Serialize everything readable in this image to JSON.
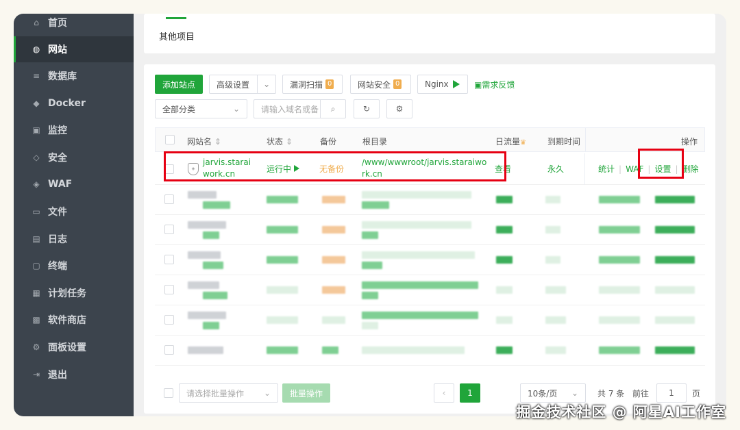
{
  "sidebar": {
    "items": [
      {
        "label": "首页",
        "icon": "home-icon",
        "glyph": "⌂"
      },
      {
        "label": "网站",
        "icon": "globe-icon",
        "glyph": "◍"
      },
      {
        "label": "数据库",
        "icon": "database-icon",
        "glyph": "≡"
      },
      {
        "label": "Docker",
        "icon": "docker-icon",
        "glyph": "◆"
      },
      {
        "label": "监控",
        "icon": "monitor-icon",
        "glyph": "▣"
      },
      {
        "label": "安全",
        "icon": "shield-icon",
        "glyph": "◇"
      },
      {
        "label": "WAF",
        "icon": "waf-shield-icon",
        "glyph": "◈"
      },
      {
        "label": "文件",
        "icon": "folder-icon",
        "glyph": "▭"
      },
      {
        "label": "日志",
        "icon": "log-icon",
        "glyph": "▤"
      },
      {
        "label": "终端",
        "icon": "terminal-icon",
        "glyph": "▢"
      },
      {
        "label": "计划任务",
        "icon": "calendar-icon",
        "glyph": "▦"
      },
      {
        "label": "软件商店",
        "icon": "apps-icon",
        "glyph": "▩"
      },
      {
        "label": "面板设置",
        "icon": "gear-icon",
        "glyph": "⚙"
      },
      {
        "label": "退出",
        "icon": "logout-icon",
        "glyph": "⇥"
      }
    ]
  },
  "top_tab": {
    "label": "其他项目"
  },
  "toolbar": {
    "add_site": "添加站点",
    "advanced": "高级设置",
    "vuln_scan": "漏洞扫描",
    "vuln_count": "0",
    "site_security": "网站安全",
    "security_count": "0",
    "nginx": "Nginx",
    "feedback": "需求反馈",
    "category": "全部分类",
    "search_placeholder": "请输入域名或备"
  },
  "table": {
    "headers": {
      "name": "网站名",
      "status": "状态",
      "backup": "备份",
      "root": "根目录",
      "traffic": "日流量",
      "expire": "到期时间",
      "ops": "操作"
    },
    "row": {
      "name_line1": "jarvis.starai",
      "name_line2": "work.cn",
      "status": "运行中",
      "backup": "无备份",
      "root_line1": "/www/wwwroot/jarvis.staraiwo",
      "root_line2": "rk.cn",
      "traffic": "查看",
      "expire": "永久",
      "op_stats": "统计",
      "op_waf": "WAF",
      "op_settings": "设置",
      "op_delete": "删除"
    }
  },
  "footer": {
    "batch_placeholder": "请选择批量操作",
    "batch_btn": "批量操作",
    "page_current": "1",
    "page_size": "10条/页",
    "total_text": "共 7 条",
    "goto": "前往",
    "goto_value": "1",
    "page_unit": "页"
  },
  "watermark": "掘金技术社区 @ 阿星AI工作室",
  "colors": {
    "accent": "#20a53a",
    "sidebar": "#3c444d",
    "highlight": "#e60012",
    "warning": "#f0ad4e"
  }
}
